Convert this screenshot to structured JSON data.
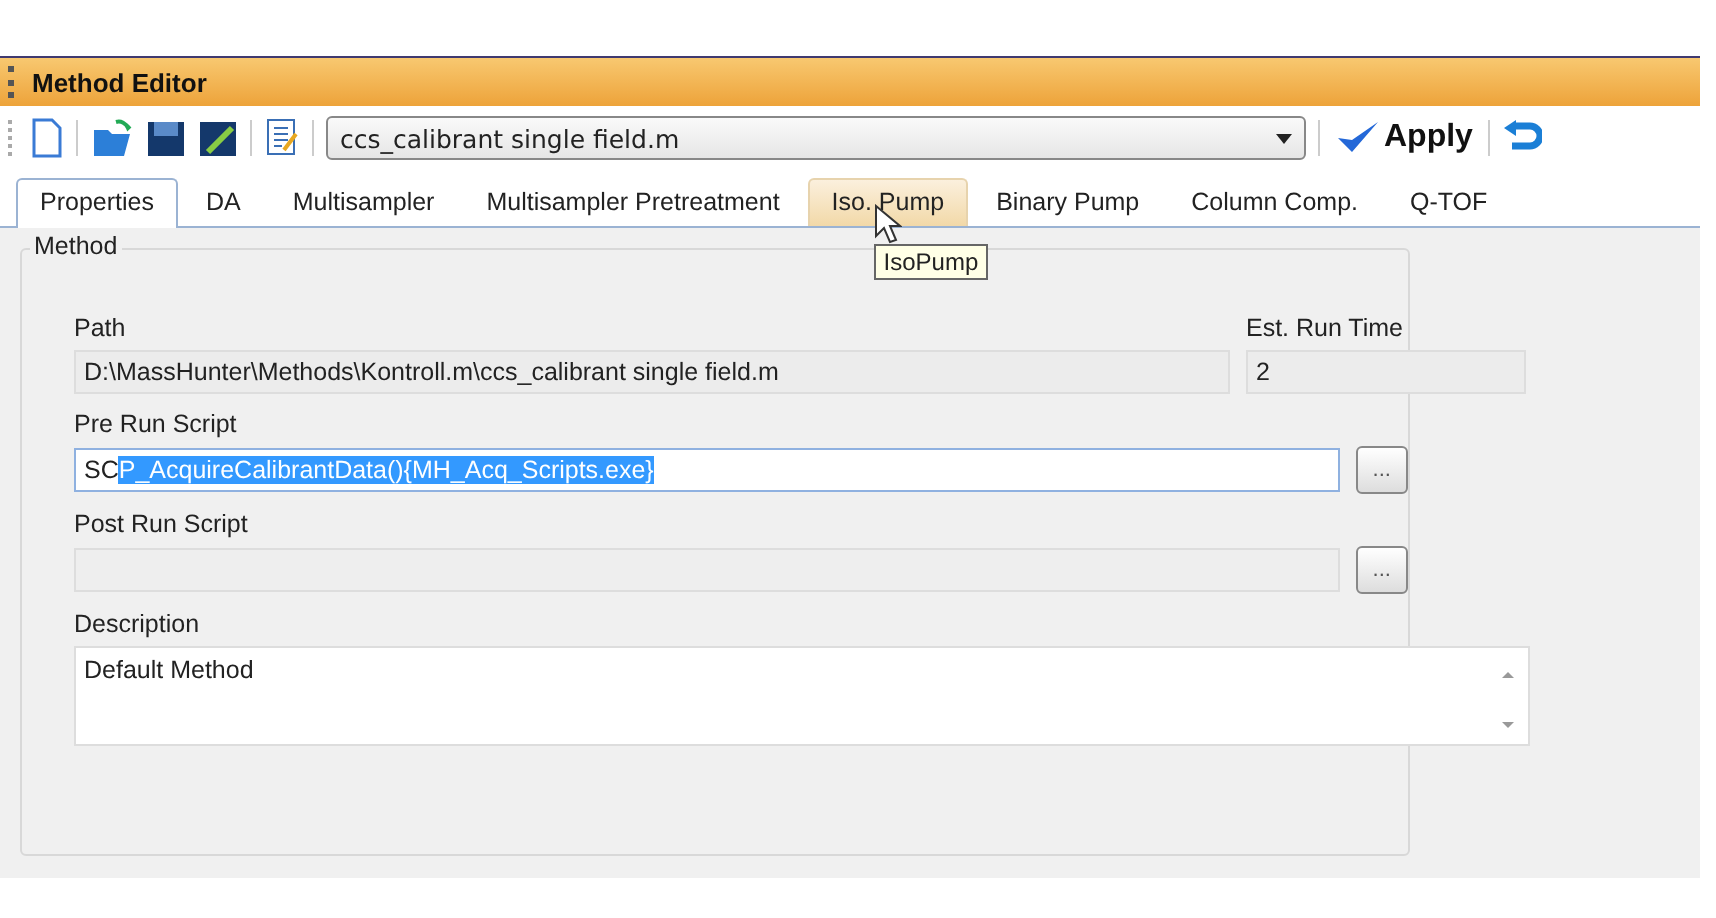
{
  "window": {
    "title": "Method Editor"
  },
  "toolbar": {
    "method_file": "ccs_calibrant single field.m",
    "apply": "Apply"
  },
  "tabs": [
    {
      "label": "Properties",
      "selected": true,
      "hovered": false
    },
    {
      "label": "DA",
      "selected": false,
      "hovered": false
    },
    {
      "label": "Multisampler",
      "selected": false,
      "hovered": false
    },
    {
      "label": "Multisampler Pretreatment",
      "selected": false,
      "hovered": false
    },
    {
      "label": "Iso. Pump",
      "selected": false,
      "hovered": true
    },
    {
      "label": "Binary Pump",
      "selected": false,
      "hovered": false
    },
    {
      "label": "Column Comp.",
      "selected": false,
      "hovered": false
    },
    {
      "label": "Q-TOF",
      "selected": false,
      "hovered": false
    }
  ],
  "tooltip": "IsoPump",
  "group": {
    "title": "Method",
    "path": {
      "label": "Path",
      "value": "D:\\MassHunter\\Methods\\Kontroll.m\\ccs_calibrant single field.m"
    },
    "run_time": {
      "label": "Est. Run Time",
      "value": "2"
    },
    "pre_run_script": {
      "label": "Pre Run Script",
      "focused": true,
      "parts": [
        {
          "text": "SC",
          "selected": false
        },
        {
          "text": "P_AcquireCalibrantData(){MH_Acq_Scripts.exe}",
          "selected": true
        }
      ],
      "browse": "..."
    },
    "post_run_script": {
      "label": "Post Run Script",
      "focused": false,
      "browse": "..."
    },
    "description": {
      "label": "Description",
      "value": "Default Method"
    }
  }
}
